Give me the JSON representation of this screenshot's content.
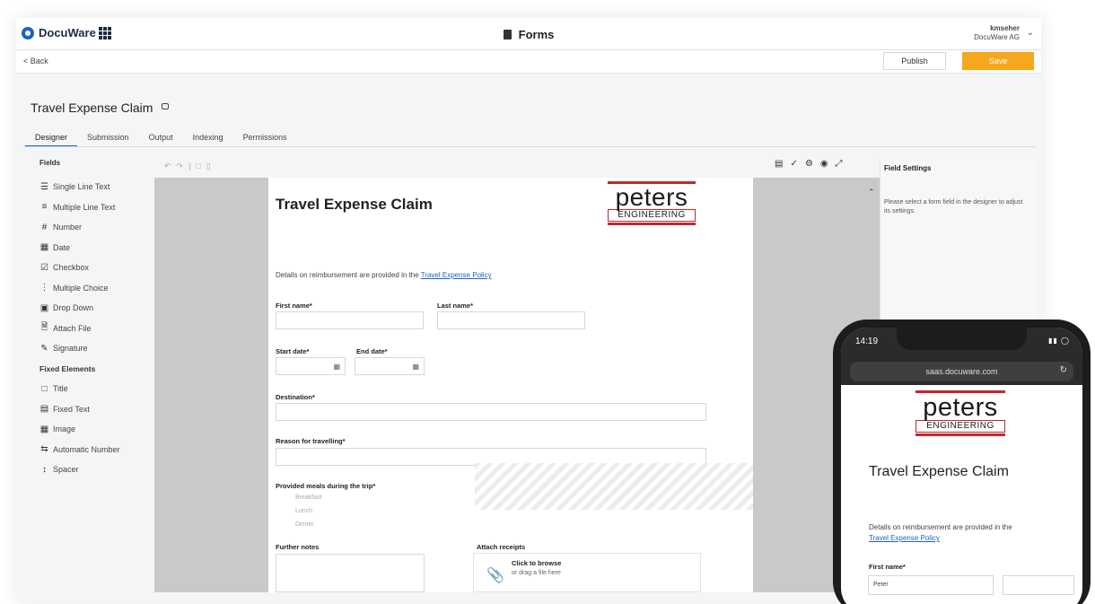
{
  "app": {
    "logo": "DocuWare",
    "title": "Forms",
    "user_name": "kmseher",
    "user_org": "DocuWare AG",
    "back": "< Back",
    "publish": "Publish",
    "save": "Save",
    "form_title": "Travel Expense Claim",
    "accent_color": "#1d63c1",
    "save_color": "#f6a81c"
  },
  "tabs": [
    "Designer",
    "Submission",
    "Output",
    "Indexing",
    "Permissions"
  ],
  "fields": {
    "header": "Fields",
    "items": [
      {
        "label": "Single Line Text",
        "icon": "single-line-text-icon"
      },
      {
        "label": "Multiple Line Text",
        "icon": "multiple-line-text-icon"
      },
      {
        "label": "Number",
        "icon": "number-icon"
      },
      {
        "label": "Date",
        "icon": "date-icon"
      },
      {
        "label": "Checkbox",
        "icon": "checkbox-icon"
      },
      {
        "label": "Multiple Choice",
        "icon": "multiple-choice-icon"
      },
      {
        "label": "Drop Down",
        "icon": "drop-down-icon"
      },
      {
        "label": "Attach File",
        "icon": "attach-file-icon"
      },
      {
        "label": "Signature",
        "icon": "signature-icon"
      }
    ],
    "fixed_header": "Fixed Elements",
    "fixed_items": [
      {
        "label": "Title",
        "icon": "title-icon"
      },
      {
        "label": "Fixed Text",
        "icon": "fixed-text-icon"
      },
      {
        "label": "Image",
        "icon": "image-icon"
      },
      {
        "label": "Automatic Number",
        "icon": "automatic-number-icon"
      },
      {
        "label": "Spacer",
        "icon": "spacer-icon"
      }
    ]
  },
  "form": {
    "title": "Travel Expense Claim",
    "logo_word": "peters",
    "logo_sub": "ENGINEERING",
    "reimb_text": "Details on reimbursement are provided in the",
    "reimb_link": "Travel Expense Policy",
    "first_name": "First name*",
    "last_name": "Last name*",
    "start_date": "Start date*",
    "end_date": "End date*",
    "destination": "Destination*",
    "reason": "Reason for travelling*",
    "meals": "Provided meals during the trip*",
    "meal_options": [
      "Breakfast",
      "Lunch",
      "Dinner"
    ],
    "further_notes": "Further notes",
    "attach_receipts": "Attach receipts",
    "click_browse": "Click to browse",
    "drag_file": "or drag a file here"
  },
  "settings": {
    "title": "Field Settings",
    "desc": "Please select a form field in the designer to adjust its settings"
  },
  "phone": {
    "time": "14:19",
    "url": "saas.docuware.com",
    "title": "Travel Expense Claim",
    "reimb_text": "Details on reimbursement are provided in the",
    "reimb_link": "Travel Expense Policy",
    "first_name": "First name*",
    "first_value": "Peter"
  }
}
